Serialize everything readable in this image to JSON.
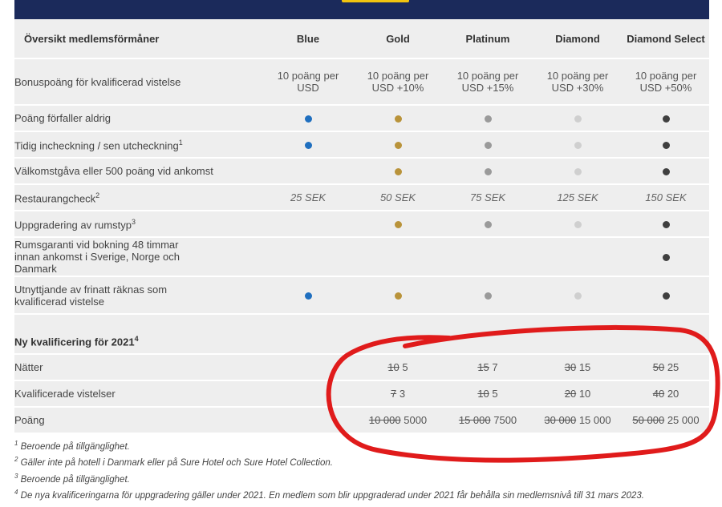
{
  "colors": {
    "header_bar": "#1b2a5b",
    "accent": "#f1c40f",
    "row_bg": "#eeeeee",
    "blue": "#1f6fbf",
    "gold": "#b9933a",
    "platinum": "#9a9a9a",
    "diamond": "#cfcfcf",
    "diamond_select": "#3f3f3f",
    "annotation_circle": "#e01b1b"
  },
  "table": {
    "header": {
      "title": "Översikt medlemsförmåner",
      "tiers": [
        "Blue",
        "Gold",
        "Platinum",
        "Diamond",
        "Diamond Select"
      ]
    },
    "rows": [
      {
        "label": "Bonuspoäng för kvalificerad vistelse",
        "values": [
          "10 poäng per USD",
          "10 poäng per USD +10%",
          "10 poäng per USD +15%",
          "10 poäng per USD +30%",
          "10 poäng per USD +50%"
        ]
      },
      {
        "label": "Poäng förfaller aldrig",
        "dots": [
          "blue",
          "gold",
          "platinum",
          "diamond",
          "diamond_select"
        ]
      },
      {
        "label": "Tidig incheckning / sen utcheckning",
        "sup": "1",
        "dots": [
          "blue",
          "gold",
          "platinum",
          "diamond",
          "diamond_select"
        ]
      },
      {
        "label": "Välkomstgåva eller 500 poäng vid ankomst",
        "dots": [
          "",
          "gold",
          "platinum",
          "diamond",
          "diamond_select"
        ]
      },
      {
        "label": "Restaurangcheck",
        "sup": "2",
        "values": [
          "25 SEK",
          "50 SEK",
          "75 SEK",
          "125 SEK",
          "150 SEK"
        ]
      },
      {
        "label": "Uppgradering av rumstyp",
        "sup": "3",
        "dots": [
          "",
          "gold",
          "platinum",
          "diamond",
          "diamond_select"
        ]
      },
      {
        "label": "Rumsgaranti vid bokning 48 timmar innan ankomst i Sverige, Norge och Danmark",
        "dots": [
          "",
          "",
          "",
          "",
          "diamond_select"
        ]
      },
      {
        "label": "Utnyttjande av frinatt räknas som kvalificerad vistelse",
        "dots": [
          "blue",
          "gold",
          "platinum",
          "diamond",
          "diamond_select"
        ]
      }
    ],
    "qualification": {
      "title": "Ny kvalificering för 2021",
      "sup": "4",
      "rows": [
        {
          "label": "Nätter",
          "cells": [
            {
              "old": "",
              "new": ""
            },
            {
              "old": "10",
              "new": "5"
            },
            {
              "old": "15",
              "new": "7"
            },
            {
              "old": "30",
              "new": "15"
            },
            {
              "old": "50",
              "new": "25"
            }
          ]
        },
        {
          "label": "Kvalificerade vistelser",
          "cells": [
            {
              "old": "",
              "new": ""
            },
            {
              "old": "7",
              "new": "3"
            },
            {
              "old": "10",
              "new": "5"
            },
            {
              "old": "20",
              "new": "10"
            },
            {
              "old": "40",
              "new": "20"
            }
          ]
        },
        {
          "label": "Poäng",
          "cells": [
            {
              "old": "",
              "new": ""
            },
            {
              "old": "10 000",
              "new": "5000"
            },
            {
              "old": "15 000",
              "new": "7500"
            },
            {
              "old": "30 000",
              "new": "15 000"
            },
            {
              "old": "50 000",
              "new": "25 000"
            }
          ]
        }
      ]
    }
  },
  "footnotes": [
    {
      "num": "1",
      "text": "Beroende på tillgänglighet."
    },
    {
      "num": "2",
      "text": "Gäller inte på hotell i Danmark eller på Sure Hotel och Sure Hotel Collection."
    },
    {
      "num": "3",
      "text": "Beroende på tillgänglighet."
    },
    {
      "num": "4",
      "text": "De nya kvalificeringarna för uppgradering gäller under 2021. En medlem som blir uppgraderad under 2021 får behålla sin medlemsnivå till 31 mars 2023."
    }
  ]
}
